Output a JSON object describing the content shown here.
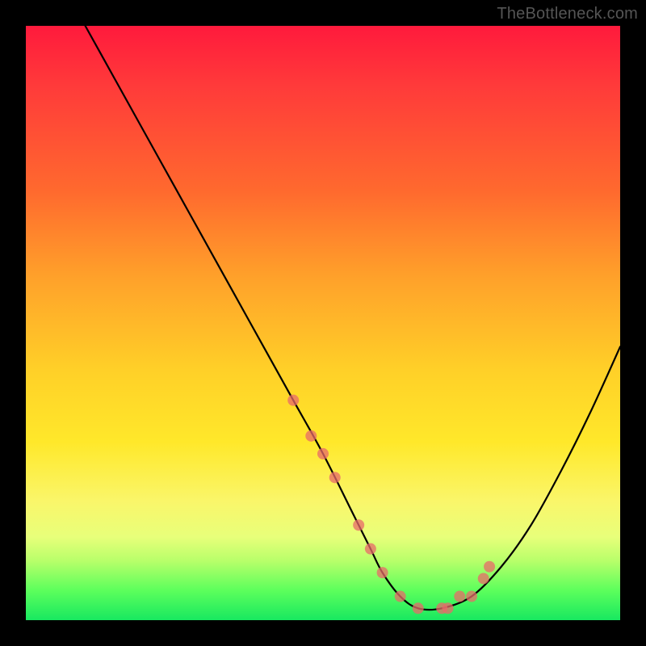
{
  "watermark": "TheBottleneck.com",
  "chart_data": {
    "type": "line",
    "title": "",
    "xlabel": "",
    "ylabel": "",
    "xlim": [
      0,
      100
    ],
    "ylim": [
      0,
      100
    ],
    "grid": false,
    "series": [
      {
        "name": "bottleneck-curve",
        "color": "#000000",
        "x": [
          10,
          15,
          20,
          25,
          30,
          35,
          40,
          45,
          50,
          55,
          58,
          60,
          63,
          66,
          70,
          75,
          80,
          85,
          90,
          95,
          100
        ],
        "values": [
          100,
          91,
          82,
          73,
          64,
          55,
          46,
          37,
          28,
          18,
          12,
          8,
          4,
          2,
          2,
          4,
          9,
          16,
          25,
          35,
          46
        ]
      }
    ],
    "markers": {
      "name": "highlight-dots",
      "color": "#e86a6a",
      "radius_px": 7,
      "x": [
        45,
        48,
        50,
        52,
        56,
        58,
        60,
        63,
        66,
        70,
        71,
        73,
        75,
        77,
        78
      ],
      "values": [
        37,
        31,
        28,
        24,
        16,
        12,
        8,
        4,
        2,
        2,
        2,
        4,
        4,
        7,
        9
      ]
    }
  }
}
